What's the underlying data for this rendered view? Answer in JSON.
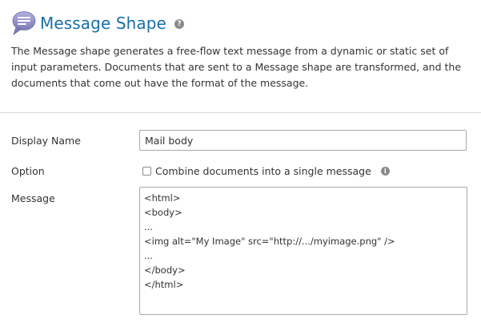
{
  "header": {
    "icon": "message-bubble-icon",
    "title": "Message Shape",
    "help_icon": "help-icon",
    "help_glyph": "?"
  },
  "description": "The Message shape generates a free-flow text message from a dynamic or static set of input parameters. Documents that are sent to a Message shape are transformed, and the documents that come out have the format of the message.",
  "form": {
    "display_name": {
      "label": "Display Name",
      "value": "Mail body"
    },
    "option": {
      "label": "Option",
      "checkbox_label": "Combine documents into a single message",
      "checked": false,
      "info_icon": "info-icon",
      "info_glyph": "i"
    },
    "message": {
      "label": "Message",
      "value": "<html>\n<body>\n...\n<img alt=\"My Image\" src=\"http://.../myimage.png\" />\n...\n</body>\n</html>"
    }
  },
  "colors": {
    "title": "#1a6fa8",
    "icon_fill": "#8e8cc4",
    "icon_lines": "#ffffff",
    "divider": "#dcdcdc"
  }
}
